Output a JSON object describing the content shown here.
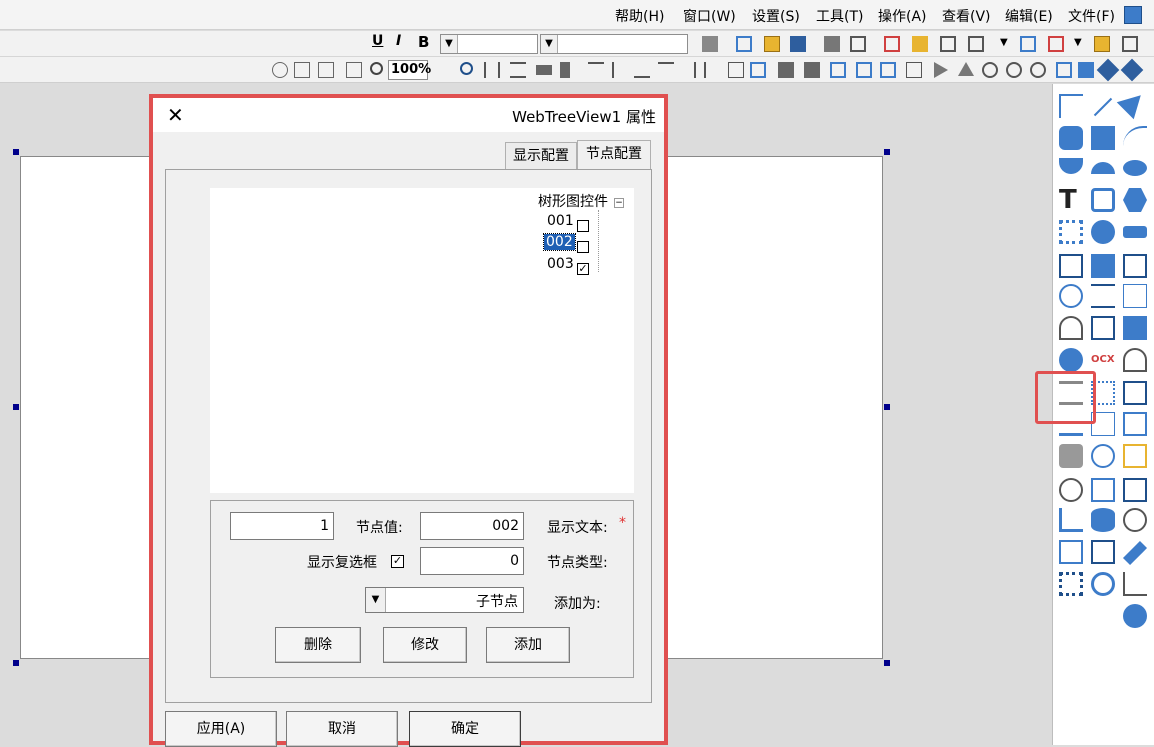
{
  "menu": [
    "帮助(H)",
    "窗口(W)",
    "设置(S)",
    "工具(T)",
    "操作(A)",
    "查看(V)",
    "编辑(E)",
    "文件(F)"
  ],
  "toolbar": {
    "zoom_value": "100%",
    "font_style": {
      "bold": "B",
      "italic": "I",
      "underline": "U"
    }
  },
  "dialog": {
    "title": "WebTreeView1 属性",
    "tabs": [
      {
        "label": "显示配置",
        "active": false
      },
      {
        "label": "节点配置",
        "active": true
      }
    ],
    "tree": {
      "root": "树形图控件",
      "expander": "−",
      "nodes": [
        {
          "label": "001",
          "checked": false,
          "selected": false
        },
        {
          "label": "002",
          "checked": false,
          "selected": true
        },
        {
          "label": "003",
          "checked": true,
          "selected": false
        }
      ]
    },
    "form": {
      "required_mark": "*",
      "display_text_label": "显示文本:",
      "display_text_value": "002",
      "node_value_label": "节点值:",
      "node_value_value": "1",
      "node_type_label": "节点类型:",
      "node_type_value": "0",
      "show_checkbox_label": "显示复选框",
      "show_checkbox_checked": true,
      "add_as_label": "添加为:",
      "add_as_value": "子节点",
      "add_button": "添加",
      "modify_button": "修改",
      "delete_button": "删除"
    },
    "footer": {
      "ok": "确定",
      "cancel": "取消",
      "apply": "应用(A)"
    }
  },
  "highlight_color": "#e05050",
  "accent_color": "#3d7cc9"
}
